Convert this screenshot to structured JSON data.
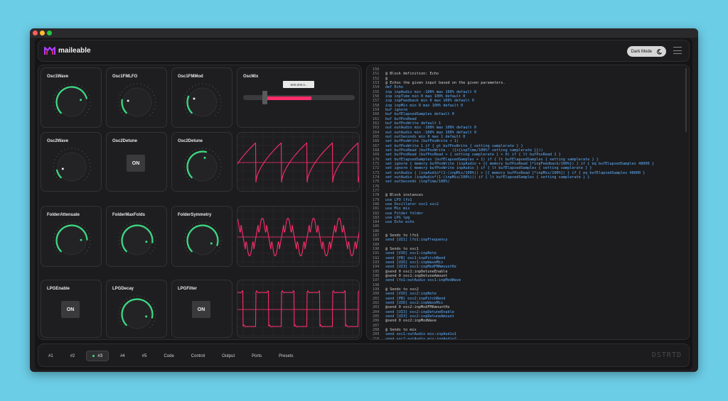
{
  "window": {
    "dots": [
      "#ff5f57",
      "#febc2e",
      "#28c840"
    ]
  },
  "header": {
    "app_name": "maileable",
    "dark_mode_label": "Dark Mode",
    "logo_icon": "maileable-logo-icon",
    "moon_icon": "moon-icon",
    "menu_icon": "hamburger-menu-icon"
  },
  "colors": {
    "accent_green": "#3ddc84",
    "accent_pink": "#ff2d6b"
  },
  "controls": {
    "osc1wave": {
      "label": "Osc1Wave",
      "value": 0.78
    },
    "osc1fmlfo": {
      "label": "Osc1FMLFO",
      "value": 0.2
    },
    "osc1fmmod": {
      "label": "Osc1FMMod",
      "value": 0.25
    },
    "oscmix": {
      "label": "OscMix",
      "display": "-500,000.0...",
      "value": 0.25
    },
    "osc2wave": {
      "label": "Osc2Wave",
      "value": 0.12
    },
    "osc2detune": {
      "label": "Osc2Detune",
      "on_label": "ON"
    },
    "osc2detune_knob": {
      "label": "Osc2Detune",
      "value": 0.55
    },
    "folderattenuate": {
      "label": "FolderAttenuate",
      "value": 0.82
    },
    "foldermaxfolds": {
      "label": "FolderMaxFolds",
      "value": 0.86
    },
    "foldersymmetry": {
      "label": "FolderSymmetry",
      "value": 0.9
    },
    "lpgenable": {
      "label": "LPGEnable",
      "on_label": "ON"
    },
    "lpgdecay": {
      "label": "LPGDecay",
      "value": 0.88
    },
    "lpgfilter": {
      "label": "LPGFilter",
      "on_label": "ON"
    }
  },
  "code": {
    "lines": [
      {
        "n": "150",
        "t": "",
        "c": "#cfcfcf"
      },
      {
        "n": "151",
        "t": "@ Block definition: Echo",
        "c": "#cfcfcf"
      },
      {
        "n": "152",
        "t": "@",
        "c": "#cfcfcf"
      },
      {
        "n": "153",
        "t": "@ Echos the given input based on the given parameters.",
        "c": "#cfcfcf"
      },
      {
        "n": "154",
        "t": "def Echo",
        "c": "#5fb0ff"
      },
      {
        "n": "155",
        "t": "inp inpAudio min -100% max 100% default 0",
        "c": "#5fb0ff"
      },
      {
        "n": "156",
        "t": "inp inpTime min 0 max 100% default 0",
        "c": "#5fb0ff"
      },
      {
        "n": "157",
        "t": "inp inpFeedback min 0 max 100% default 0",
        "c": "#5fb0ff"
      },
      {
        "n": "158",
        "t": "inp inpMix min 0 max 100% default 0",
        "c": "#5fb0ff"
      },
      {
        "n": "159",
        "t": "buf ignore",
        "c": "#5fb0ff"
      },
      {
        "n": "160",
        "t": "buf bufElapsedSamples default 0",
        "c": "#5fb0ff"
      },
      {
        "n": "161",
        "t": "buf bufPosRead",
        "c": "#5fb0ff"
      },
      {
        "n": "162",
        "t": "buf bufPosWrite default 1",
        "c": "#5fb0ff"
      },
      {
        "n": "163",
        "t": "out outAudio min -100% max 100% default 0",
        "c": "#5fb0ff"
      },
      {
        "n": "164",
        "t": "out outAudio min -100% max 100% default 0",
        "c": "#5fb0ff"
      },
      {
        "n": "165",
        "t": "out outSeconds min 0 max 1 default 0",
        "c": "#5fb0ff"
      },
      {
        "n": "166",
        "t": "set bufPosWrite (bufPosWrite + 1)",
        "c": "#5fb0ff"
      },
      {
        "n": "167",
        "t": "set bufPosWrite 1 if { gt bufPosWrite { setting samplerate } }",
        "c": "#5fb0ff"
      },
      {
        "n": "168",
        "t": "set bufPosRead (bufPosWrite - ({+{inpTime/100%* setting samplerate }}))",
        "c": "#5fb0ff"
      },
      {
        "n": "169",
        "t": "set bufPosRead (bufPosRead + { setting samplerate } + 0) if { lt bufPosRead 1 }",
        "c": "#5fb0ff"
      },
      {
        "n": "170",
        "t": "set bufElapsedSamples (bufElapsedSamples + 1) if { lt bufElapsedSamples { setting samplerate } }",
        "c": "#5fb0ff"
      },
      {
        "n": "171",
        "t": "set ignore { memory bufPosWrite (inpAudio + {{ memory bufPosRead }*inpFeedback/100%}) } if { eq bufElapsedSamples 48000 }",
        "c": "#5fb0ff"
      },
      {
        "n": "172",
        "t": "set ignore { memory bufPosWrite inpAudio } if { lt bufElapsedSamples { setting samplerate } }",
        "c": "#5fb0ff"
      },
      {
        "n": "173",
        "t": "set outAudio { (inpAudio*(1-(inpMix/100%)) + [{ memory bufPosRead }*inpMix/100%]) } if { eq bufElapsedSamples 48000 }",
        "c": "#5fb0ff"
      },
      {
        "n": "174",
        "t": "set outAudio (inpAudio*(1-(inpMix/100%))) if { lt bufElapsedSamples { setting samplerate } }",
        "c": "#5fb0ff"
      },
      {
        "n": "175",
        "t": "set outSeconds (inpTime/100%)",
        "c": "#5fb0ff"
      },
      {
        "n": "176",
        "t": "",
        "c": "#cfcfcf"
      },
      {
        "n": "177",
        "t": "",
        "c": "#cfcfcf"
      },
      {
        "n": "178",
        "t": "@ Block instances",
        "c": "#cfcfcf"
      },
      {
        "n": "179",
        "t": "use LFO lfo1",
        "c": "#5fb0ff"
      },
      {
        "n": "180",
        "t": "use Oscillator osc1 osc2",
        "c": "#5fb0ff"
      },
      {
        "n": "181",
        "t": "use Mix mix",
        "c": "#5fb0ff"
      },
      {
        "n": "182",
        "t": "use Folder folder",
        "c": "#5fb0ff"
      },
      {
        "n": "183",
        "t": "use LPG lpg",
        "c": "#5fb0ff"
      },
      {
        "n": "184",
        "t": "use Echo echo",
        "c": "#5fb0ff"
      },
      {
        "n": "185",
        "t": "",
        "c": "#cfcfcf"
      },
      {
        "n": "186",
        "t": "",
        "c": "#cfcfcf"
      },
      {
        "n": "187",
        "t": "@ Sends to lfo1",
        "c": "#cfcfcf"
      },
      {
        "n": "188",
        "t": "send [UI1] lfo1:inpFrequency",
        "c": "#5fb0ff"
      },
      {
        "n": "189",
        "t": "",
        "c": "#cfcfcf"
      },
      {
        "n": "190",
        "t": "@ Sends to osc1",
        "c": "#cfcfcf"
      },
      {
        "n": "191",
        "t": "send [VI0] osc1:inpNote",
        "c": "#5fb0ff"
      },
      {
        "n": "192",
        "t": "send [PB] osc1:inpPitchBend",
        "c": "#5fb0ff"
      },
      {
        "n": "193",
        "t": "send [UI6] osc1:inpWaveMix",
        "c": "#5fb0ff"
      },
      {
        "n": "194",
        "t": "send [UI3] osc1:inpModFMAmountHz",
        "c": "#5fb0ff"
      },
      {
        "n": "195",
        "t": "@send 0 osc1:inpDetuneEnable",
        "c": "#cfcfcf"
      },
      {
        "n": "196",
        "t": "@send 0 osc1:inpDetuneAmount",
        "c": "#cfcfcf"
      },
      {
        "n": "197",
        "t": "send lfo1:outAudio osc1:inpModWave",
        "c": "#5fb0ff"
      },
      {
        "n": "198",
        "t": "",
        "c": "#cfcfcf"
      },
      {
        "n": "199",
        "t": "@ Sends to osc2",
        "c": "#cfcfcf"
      },
      {
        "n": "200",
        "t": "send [VI0] osc2:inpNote",
        "c": "#5fb0ff"
      },
      {
        "n": "201",
        "t": "send [PB] osc2:inpPitchBend",
        "c": "#5fb0ff"
      },
      {
        "n": "202",
        "t": "send [UI6] osc2:inpWaveMix",
        "c": "#5fb0ff"
      },
      {
        "n": "203",
        "t": "@send 0 osc2:inpModFMAmountHz",
        "c": "#cfcfcf"
      },
      {
        "n": "204",
        "t": "send [UI3] osc2:inpDetuneEnable",
        "c": "#5fb0ff"
      },
      {
        "n": "205",
        "t": "send [UI3] osc2:inpDetuneAmount",
        "c": "#5fb0ff"
      },
      {
        "n": "206",
        "t": "@send 0 osc2:inpModWave",
        "c": "#cfcfcf"
      },
      {
        "n": "207",
        "t": "",
        "c": "#cfcfcf"
      },
      {
        "n": "208",
        "t": "@ Sends to mix",
        "c": "#cfcfcf"
      },
      {
        "n": "209",
        "t": "send osc1:outAudio mix:inpAudio1",
        "c": "#5fb0ff"
      },
      {
        "n": "210",
        "t": "send osc2:outAudio mix:inpAudio2",
        "c": "#5fb0ff"
      },
      {
        "n": "211",
        "t": "send [UI7] mix:inpBalance",
        "c": "#5fb0ff"
      }
    ]
  },
  "footer": {
    "tabs": [
      "#1",
      "#2",
      "#3",
      "#4",
      "#5",
      "Code",
      "Control",
      "Output",
      "Ports",
      "Presets"
    ],
    "active_tab": "#3",
    "brand": "DSTRTD"
  }
}
